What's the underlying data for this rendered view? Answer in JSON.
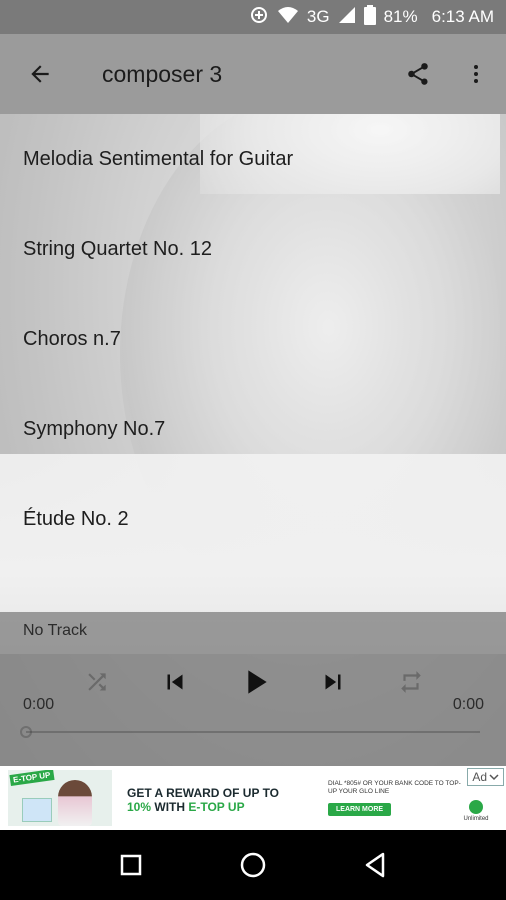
{
  "status_bar": {
    "network": "3G",
    "battery": "81%",
    "time": "6:13 AM"
  },
  "toolbar": {
    "title": "composer 3"
  },
  "tracks": [
    {
      "title": "Melodia Sentimental for Guitar"
    },
    {
      "title": "String Quartet No. 12"
    },
    {
      "title": "Choros n.7"
    },
    {
      "title": "Symphony No.7"
    },
    {
      "title": "Étude No. 2"
    }
  ],
  "player": {
    "now_playing": "No Track",
    "elapsed": "0:00",
    "duration": "0:00",
    "progress": 0
  },
  "ad": {
    "badge": "E-TOP UP",
    "headline_1": "GET A REWARD OF UP TO",
    "headline_2_green": "10%",
    "headline_2_rest": " WITH ",
    "headline_2_green2": "E-TOP UP",
    "small_text": "DIAL *805# OR YOUR BANK CODE TO TOP-UP YOUR GLO LINE",
    "cta": "LEARN MORE",
    "ad_label": "Ad",
    "brand": "Unlimited"
  }
}
